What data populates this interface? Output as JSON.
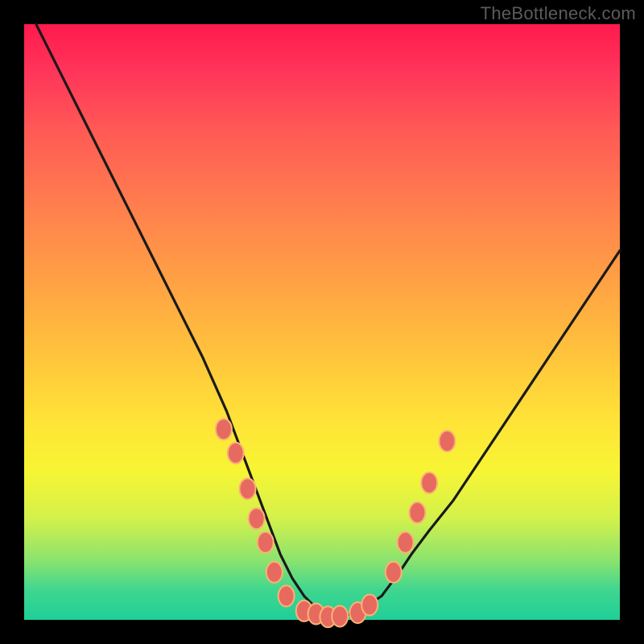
{
  "watermark": "TheBottleneck.com",
  "colors": {
    "frame_bg": "#000000",
    "curve_stroke": "#1a1a1a",
    "dot_fill": "#e66a60",
    "dot_stroke": "#fbb374"
  },
  "chart_data": {
    "type": "line",
    "title": "",
    "xlabel": "",
    "ylabel": "",
    "xlim": [
      0,
      100
    ],
    "ylim": [
      0,
      100
    ],
    "grid": false,
    "legend": false,
    "series": [
      {
        "name": "bottleneck-curve",
        "x": [
          2,
          6,
          10,
          14,
          18,
          22,
          26,
          30,
          34,
          37,
          40,
          43,
          45,
          47,
          49,
          51,
          53,
          55,
          57,
          60,
          63,
          65,
          68,
          72,
          76,
          80,
          84,
          88,
          92,
          96,
          100
        ],
        "y": [
          100,
          92,
          84,
          76,
          68,
          60,
          52,
          44,
          35,
          27,
          19,
          11,
          7,
          4,
          2,
          1,
          0.5,
          1,
          2,
          4,
          8,
          11,
          15,
          20,
          26,
          32,
          38,
          44,
          50,
          56,
          62
        ]
      }
    ],
    "markers": {
      "name": "highlight-dots",
      "points": [
        {
          "x": 33.5,
          "y": 32
        },
        {
          "x": 35.5,
          "y": 28
        },
        {
          "x": 37.5,
          "y": 22
        },
        {
          "x": 39,
          "y": 17
        },
        {
          "x": 40.5,
          "y": 13
        },
        {
          "x": 42,
          "y": 8
        },
        {
          "x": 44,
          "y": 4
        },
        {
          "x": 47,
          "y": 1.5
        },
        {
          "x": 49,
          "y": 1
        },
        {
          "x": 51,
          "y": 0.5
        },
        {
          "x": 53,
          "y": 0.6
        },
        {
          "x": 56,
          "y": 1.2
        },
        {
          "x": 58,
          "y": 2.5
        },
        {
          "x": 62,
          "y": 8
        },
        {
          "x": 64,
          "y": 13
        },
        {
          "x": 66,
          "y": 18
        },
        {
          "x": 68,
          "y": 23
        },
        {
          "x": 71,
          "y": 30
        }
      ]
    }
  }
}
